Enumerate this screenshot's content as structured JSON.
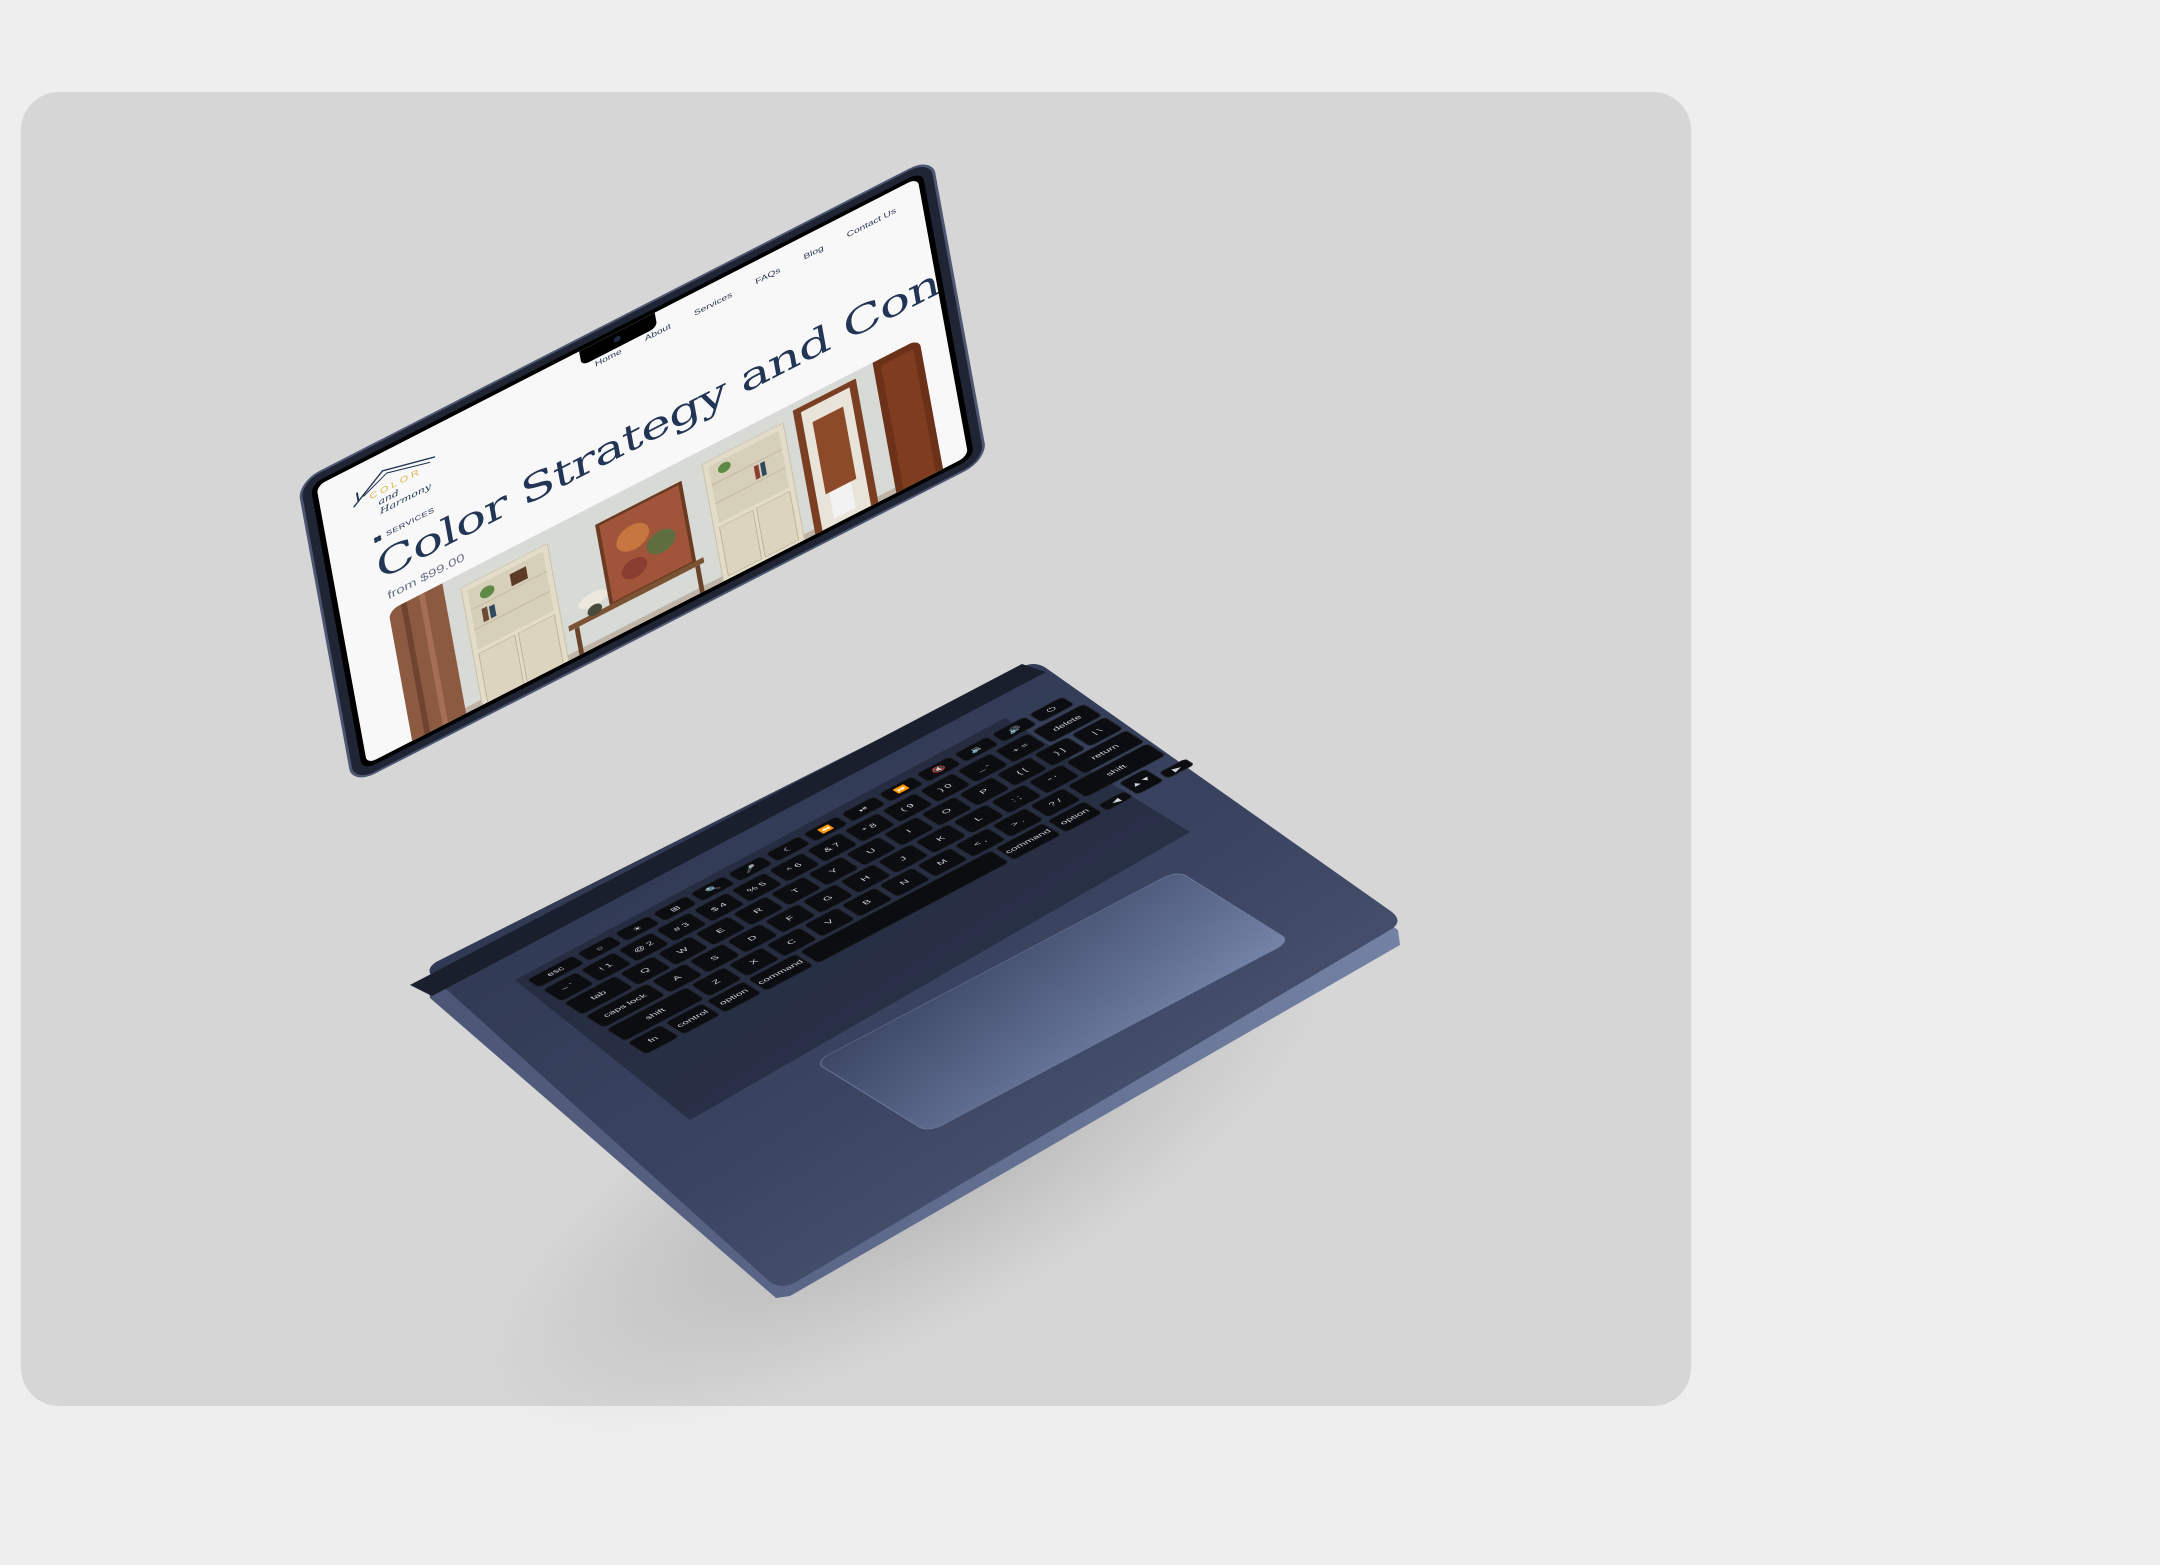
{
  "site": {
    "logo": {
      "line1": "COLOR",
      "line2": "and Harmony"
    },
    "nav": [
      "Home",
      "About",
      "Services",
      "FAQs",
      "Blog",
      "Contact Us"
    ],
    "eyebrow": "SERVICES",
    "title": "Color Strategy and Consultation",
    "price": "from $99.00"
  },
  "keyboard": {
    "rows": [
      [
        "esc",
        "☼",
        "☀",
        "⊞",
        "🔍",
        "🎤",
        "☾",
        "⏪",
        "⏯",
        "⏩",
        "🔇",
        "🔉",
        "🔊",
        "⏻"
      ],
      [
        "~ `",
        "! 1",
        "@ 2",
        "# 3",
        "$ 4",
        "% 5",
        "^ 6",
        "& 7",
        "* 8",
        "( 9",
        ") 0",
        "_ -",
        "+ =",
        "delete"
      ],
      [
        "tab",
        "Q",
        "W",
        "E",
        "R",
        "T",
        "Y",
        "U",
        "I",
        "O",
        "P",
        "{ [",
        "} ]",
        "| \\"
      ],
      [
        "caps lock",
        "A",
        "S",
        "D",
        "F",
        "G",
        "H",
        "J",
        "K",
        "L",
        ": ;",
        "\" '",
        "return"
      ],
      [
        "shift",
        "Z",
        "X",
        "C",
        "V",
        "B",
        "N",
        "M",
        "< ,",
        "> .",
        "? /",
        "shift"
      ],
      [
        "fn",
        "control",
        "option",
        "command",
        "",
        "command",
        "option",
        "◀",
        "▲▼",
        "▶"
      ]
    ]
  },
  "colors": {
    "brand_navy": "#223554",
    "brand_gold": "#d9b94a",
    "laptop_body": "#2e3650"
  }
}
